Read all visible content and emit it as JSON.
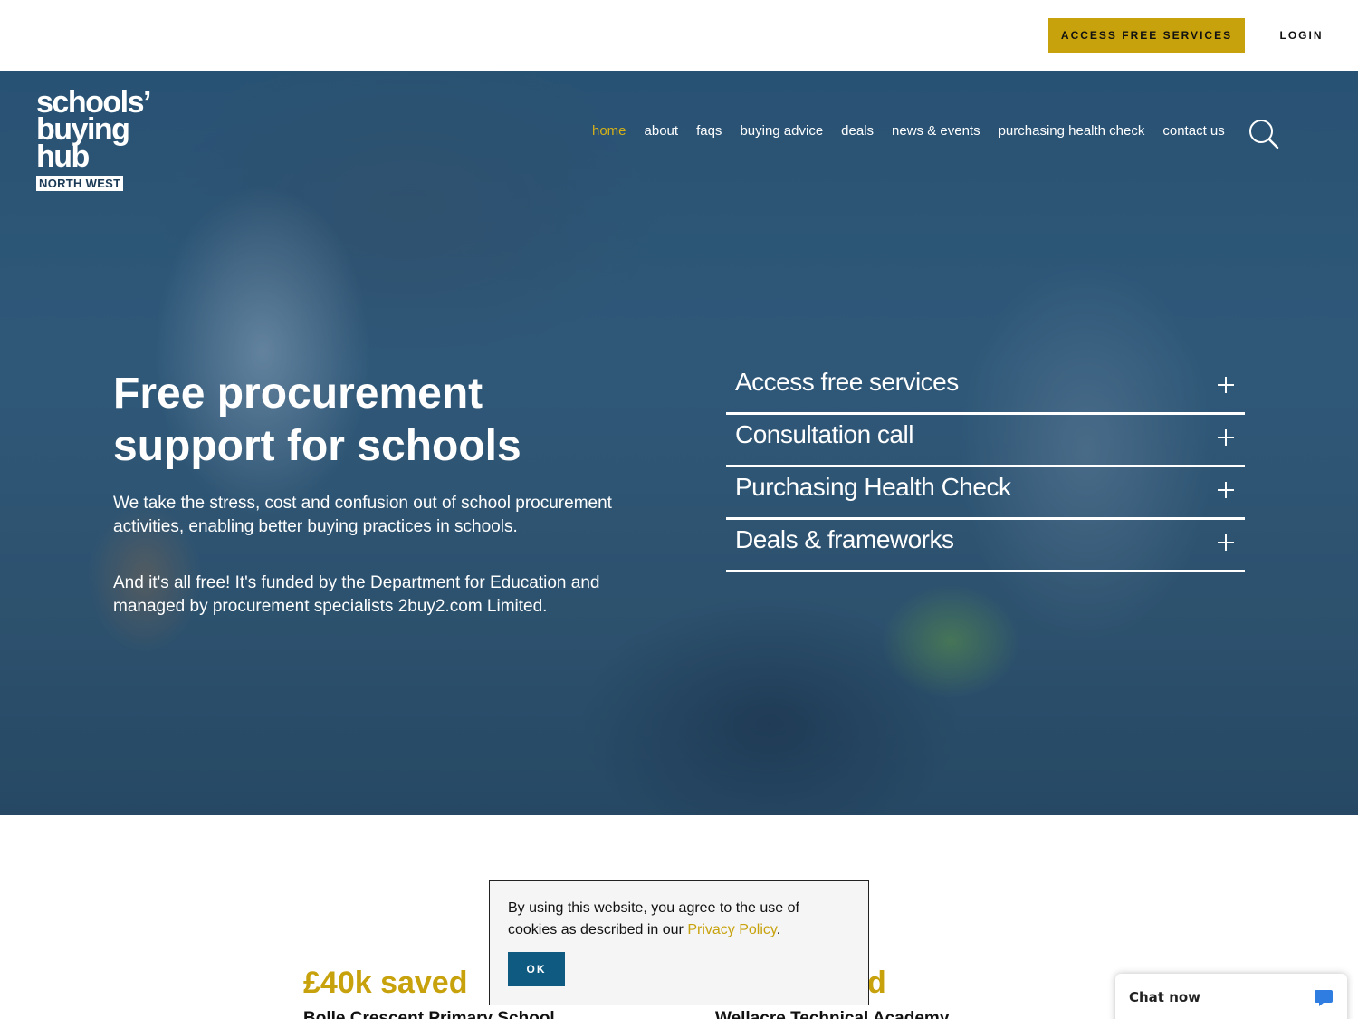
{
  "topbar": {
    "access_label": "ACCESS FREE SERVICES",
    "login_label": "LOGIN"
  },
  "logo": {
    "line1": "schools’",
    "line2": "buying",
    "line3": "hub",
    "region": "NORTH WEST"
  },
  "nav": {
    "items": [
      {
        "label": "home",
        "active": true
      },
      {
        "label": "about"
      },
      {
        "label": "faqs"
      },
      {
        "label": "buying advice"
      },
      {
        "label": "deals"
      },
      {
        "label": "news & events"
      },
      {
        "label": "purchasing health check"
      },
      {
        "label": "contact us"
      }
    ],
    "search_icon": "search-icon"
  },
  "hero": {
    "title": "Free procurement support for schools",
    "para1": "We take the stress, cost and confusion out of school procurement activities, enabling better buying practices in schools.",
    "para2": "And it's all free! It's funded by the Department for Education and managed by procurement specialists 2buy2.com Limited."
  },
  "accordion": [
    {
      "label": "Access free services"
    },
    {
      "label": "Consultation call"
    },
    {
      "label": "Purchasing Health Check"
    },
    {
      "label": "Deals & frameworks"
    }
  ],
  "stats": [
    {
      "value": "£40k saved",
      "school": "Bolle Crescent Primary School"
    },
    {
      "value": "d",
      "school": "Wellacre Technical Academy"
    }
  ],
  "cookie": {
    "text_before": "By using this website, you agree to the use of cookies as described in our ",
    "link_label": "Privacy Policy",
    "text_after": ".",
    "ok_label": "OK"
  },
  "chat": {
    "label": "Chat now"
  },
  "colors": {
    "accent": "#c7a20c",
    "ok_button": "#0e5a80"
  }
}
